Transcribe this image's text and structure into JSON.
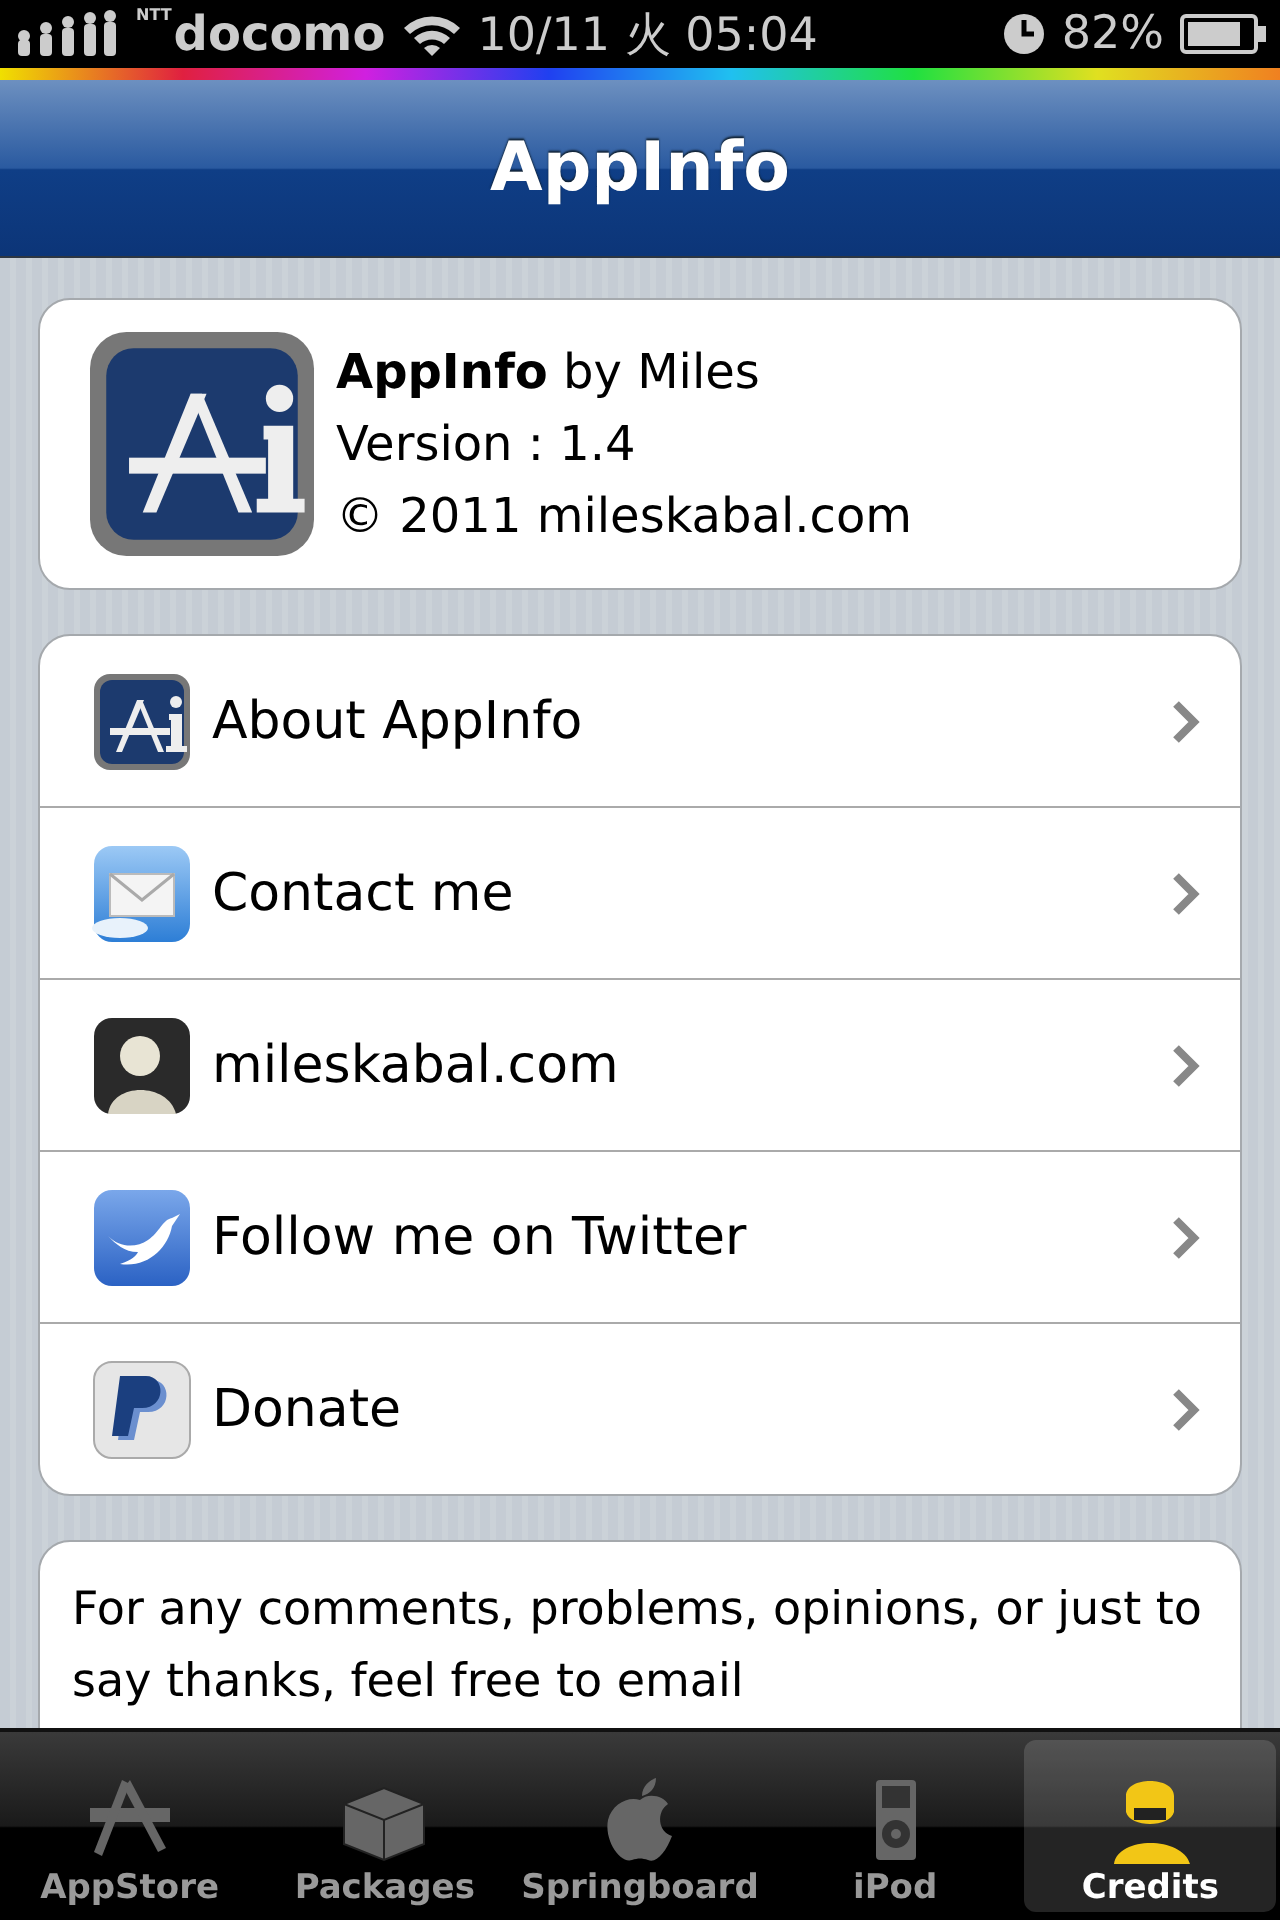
{
  "status_bar": {
    "carrier_mark": "NTT",
    "carrier": "docomo",
    "datetime": "10/11 火 05:04",
    "battery": "82%"
  },
  "nav_bar": {
    "title": "AppInfo"
  },
  "app_card": {
    "name_line": "**AppInfo** by Miles",
    "version": "Version : 1.4",
    "copyright": "© 2011 mileskabal.com"
  },
  "links": [
    {
      "kind": "appinfo",
      "label": "About AppInfo"
    },
    {
      "kind": "mail",
      "label": "Contact me"
    },
    {
      "kind": "site",
      "label": "mileskabal.com"
    },
    {
      "kind": "twitter",
      "label": "Follow me on Twitter"
    },
    {
      "kind": "paypal",
      "label": "Donate"
    }
  ],
  "message": "For any comments, problems, opinions, or just to say thanks, feel free to email",
  "tab_bar": [
    {
      "kind": "appstore",
      "label": "AppStore",
      "selected": false
    },
    {
      "kind": "packages",
      "label": "Packages",
      "selected": false
    },
    {
      "kind": "springboard",
      "label": "Springboard",
      "selected": false
    },
    {
      "kind": "ipod",
      "label": "iPod",
      "selected": false
    },
    {
      "kind": "credits",
      "label": "Credits",
      "selected": true
    }
  ]
}
